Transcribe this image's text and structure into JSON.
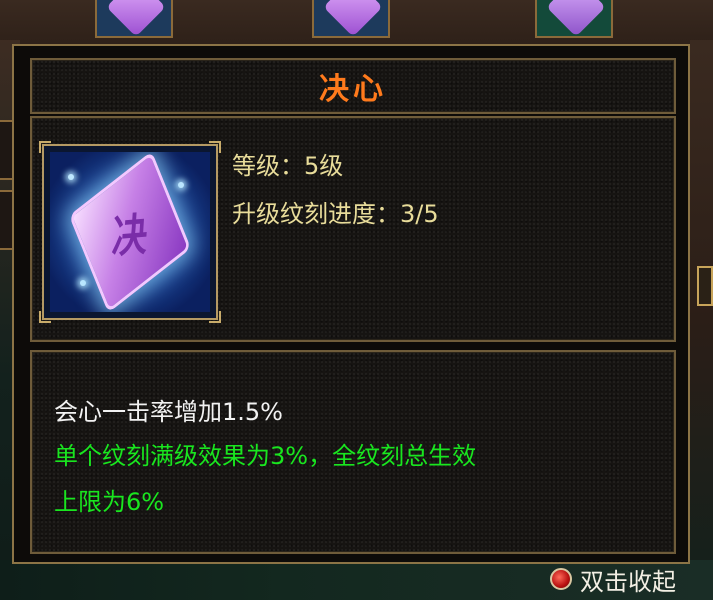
{
  "tooltip": {
    "title": "决心",
    "icon": {
      "name": "jue-rune-icon",
      "glyph": "决"
    },
    "level_line": "等级：5级",
    "progress_line": "升级纹刻进度：3/5",
    "effect_line": "会心一击率增加1.5%",
    "note_line_1": "单个纹刻满级效果为3%，全纹刻总生效",
    "note_line_2": "上限为6%"
  },
  "background": {
    "bottom_right_label": "双击收起"
  },
  "colors": {
    "title": "#ff7a1c",
    "stat_text": "#e8dc9a",
    "effect_text": "#f2f2f2",
    "note_text": "#19e61f",
    "frame_gold": "#8c7446"
  }
}
